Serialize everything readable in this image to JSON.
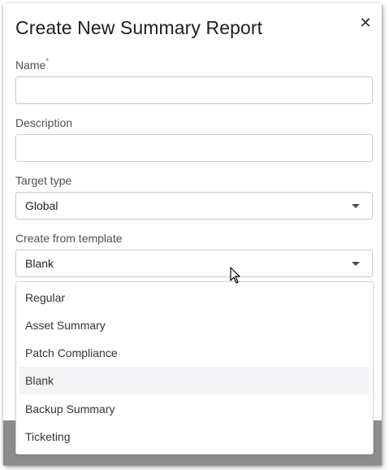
{
  "dialog": {
    "title": "Create New Summary Report",
    "close_glyph": "✕"
  },
  "form": {
    "name_label": "Name",
    "name_required_mark": "*",
    "name_value": "",
    "description_label": "Description",
    "description_value": "",
    "target_type_label": "Target type",
    "target_type_value": "Global",
    "template_label": "Create from template",
    "template_value": "Blank"
  },
  "dropdown": {
    "items": [
      {
        "label": "Regular"
      },
      {
        "label": "Asset Summary"
      },
      {
        "label": "Patch Compliance"
      },
      {
        "label": "Blank",
        "highlighted": true
      },
      {
        "label": "Backup Summary"
      },
      {
        "label": "Ticketing"
      }
    ]
  },
  "icons": {
    "close": "close-icon",
    "caret": "chevron-down-icon",
    "cursor": "mouse-pointer-icon"
  },
  "colors": {
    "highlight": "#f4f4f6",
    "border": "#c8c8c8",
    "footer_band": "#8c8c8c"
  }
}
